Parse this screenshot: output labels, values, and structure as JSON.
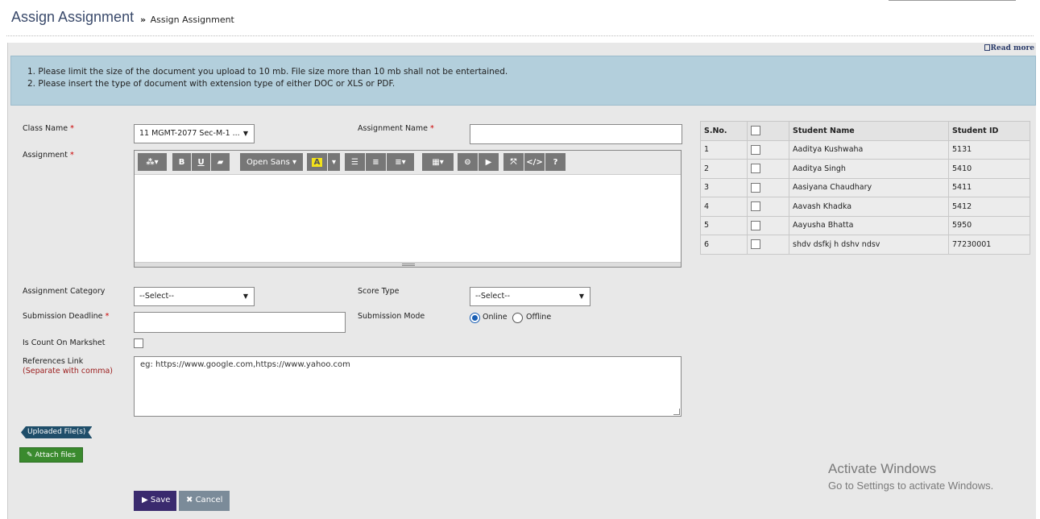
{
  "header": {
    "title": "Assign Assignment",
    "breadcrumb_sep": "»",
    "breadcrumb": "Assign Assignment"
  },
  "read_more": "Read more",
  "notices": [
    "1. Please limit the size of the document you upload to 10 mb. File size more than 10 mb shall not be entertained.",
    "2. Please insert the type of document with extension type of either DOC or XLS or PDF."
  ],
  "form": {
    "class_name_label": "Class Name",
    "class_name_value": "11 MGMT-2077 Sec-M-1 ...",
    "assignment_name_label": "Assignment Name",
    "assignment_name_value": "",
    "assignment_label": "Assignment",
    "required_mark": "*",
    "assignment_category_label": "Assignment Category",
    "assignment_category_value": "--Select--",
    "score_type_label": "Score Type",
    "score_type_value": "--Select--",
    "submission_deadline_label": "Submission Deadline",
    "submission_deadline_value": "",
    "submission_mode_label": "Submission Mode",
    "mode_online": "Online",
    "mode_offline": "Offline",
    "mode_selected": "Online",
    "is_count_label": "Is Count On Markshet",
    "references_label": "References Link",
    "references_sub": "(Separate with comma)",
    "references_placeholder": "eg: https://www.google.com,https://www.yahoo.com"
  },
  "editor": {
    "font_name": "Open Sans",
    "toolbar_icons": [
      "magic-icon",
      "bold-icon",
      "underline-icon",
      "eraser-icon",
      "font-dropdown",
      "highlight-icon",
      "ul-icon",
      "ol-icon",
      "align-icon",
      "table-icon",
      "link-icon",
      "video-icon",
      "fullscreen-icon",
      "code-icon",
      "help-icon"
    ]
  },
  "buttons": {
    "uploaded_files": "Uploaded File(s)",
    "attach_files": "Attach files",
    "save": "Save",
    "cancel": "Cancel"
  },
  "students": {
    "headers": [
      "S.No.",
      "",
      "Student Name",
      "Student ID"
    ],
    "rows": [
      {
        "sno": "1",
        "name": "Aaditya Kushwaha",
        "id": "5131"
      },
      {
        "sno": "2",
        "name": "Aaditya Singh",
        "id": "5410"
      },
      {
        "sno": "3",
        "name": "Aasiyana Chaudhary",
        "id": "5411"
      },
      {
        "sno": "4",
        "name": "Aavash Khadka",
        "id": "5412"
      },
      {
        "sno": "5",
        "name": "Aayusha Bhatta",
        "id": "5950"
      },
      {
        "sno": "6",
        "name": "shdv dsfkj h dshv ndsv",
        "id": "77230001"
      }
    ]
  },
  "watermark": {
    "line1": "Activate Windows",
    "line2": "Go to Settings to activate Windows."
  },
  "colors": {
    "info_bg": "#b3cfdc",
    "save_bg": "#3a2a6e",
    "attach_bg": "#3a8a2e",
    "title_color": "#3a4a6b"
  }
}
